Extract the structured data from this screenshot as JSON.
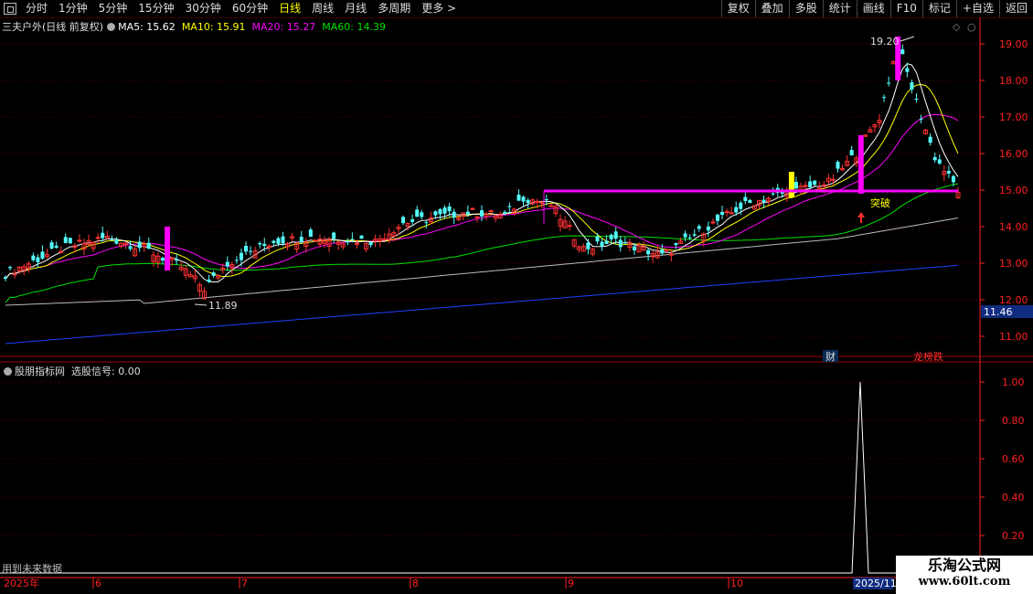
{
  "toolbar": {
    "left": [
      "分时",
      "1分钟",
      "5分钟",
      "15分钟",
      "30分钟",
      "60分钟",
      "日线",
      "周线",
      "月线",
      "多周期",
      "更多 >"
    ],
    "active": "日线",
    "right": [
      "复权",
      "叠加",
      "多股",
      "统计",
      "画线",
      "F10",
      "标记",
      "+自选",
      "返回"
    ]
  },
  "header": {
    "stock": "三夫户外(日线 前复权)",
    "ma5_label": "MA5: 15.62",
    "ma10_label": "MA10: 15.91",
    "ma20_label": "MA20: 15.27",
    "ma60_label": "MA60: 14.39"
  },
  "colors": {
    "up": "#ff3232",
    "down": "#54fcfc",
    "ma5": "#ffffff",
    "ma10": "#ffff00",
    "ma20": "#ff00ff",
    "ma60": "#00e000",
    "ma120": "#bbbbbb",
    "ma250": "#2040ff",
    "line": "#ff00ff",
    "axis": "#ff2020"
  },
  "price_axis": [
    "19.00",
    "18.00",
    "17.00",
    "16.00",
    "15.00",
    "14.00",
    "13.00",
    "12.00",
    "11.00"
  ],
  "current_price_label": "11.46",
  "annotations": {
    "high": "19.20",
    "low": "11.89",
    "breakout": "突破",
    "fin_marker": "财",
    "rank_marker": "龙榜跌"
  },
  "indicator": {
    "title": "股朋指标网",
    "signal_label": "选股信号: 0.00",
    "axis": [
      "1.00",
      "0.80",
      "0.60",
      "0.40",
      "0.20"
    ],
    "signal_value": 1.0
  },
  "future_note": "用到未来数据",
  "x_axis": {
    "year": "2025年",
    "months": [
      "6",
      "7",
      "8",
      "9",
      "10"
    ],
    "end_label": "2025/11"
  },
  "watermark": {
    "title": "乐淘公式网",
    "url": "www.60lt.com"
  }
}
